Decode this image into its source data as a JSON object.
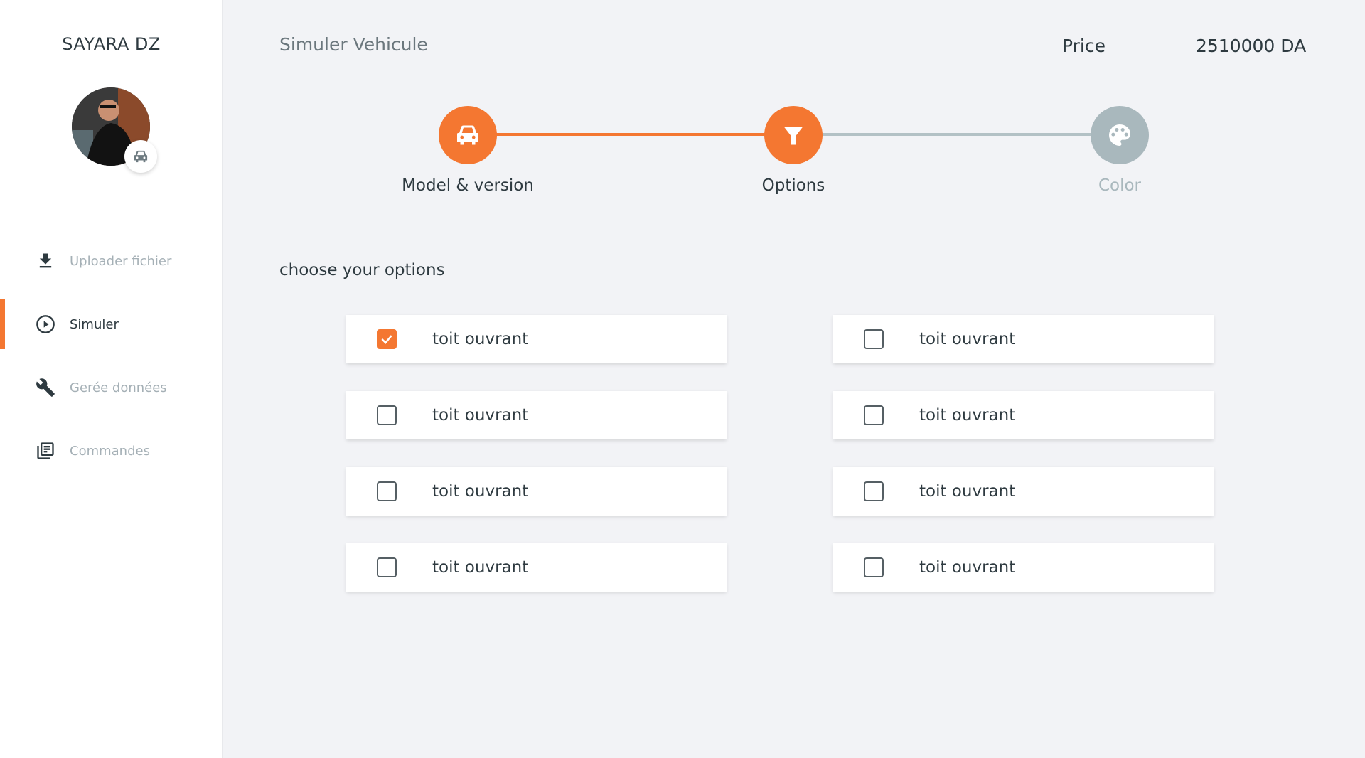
{
  "sidebar": {
    "brand": "SAYARA DZ",
    "items": [
      {
        "label": "Uploader fichier",
        "icon": "download-icon",
        "active": false
      },
      {
        "label": "Simuler",
        "icon": "play-circle-icon",
        "active": true
      },
      {
        "label": "Gerée données",
        "icon": "wrench-icon",
        "active": false
      },
      {
        "label": "Commandes",
        "icon": "library-books-icon",
        "active": false
      }
    ]
  },
  "header": {
    "title": "Simuler Vehicule",
    "price_label": "Price",
    "price_value": "2510000 DA"
  },
  "stepper": {
    "steps": [
      {
        "label": "Model & version",
        "icon": "car-icon",
        "state": "completed"
      },
      {
        "label": "Options",
        "icon": "filter-icon",
        "state": "active"
      },
      {
        "label": "Color",
        "icon": "palette-icon",
        "state": "inactive"
      }
    ]
  },
  "options": {
    "title": "choose your options",
    "items": [
      {
        "label": "toit ouvrant",
        "checked": true
      },
      {
        "label": "toit ouvrant",
        "checked": false
      },
      {
        "label": "toit ouvrant",
        "checked": false
      },
      {
        "label": "toit ouvrant",
        "checked": false
      },
      {
        "label": "toit ouvrant",
        "checked": false
      },
      {
        "label": "toit ouvrant",
        "checked": false
      },
      {
        "label": "toit ouvrant",
        "checked": false
      },
      {
        "label": "toit ouvrant",
        "checked": false
      }
    ]
  },
  "colors": {
    "accent": "#f47731",
    "inactive": "#a9b8bd",
    "text": "#2e3a40",
    "muted": "#a5b0b6"
  }
}
